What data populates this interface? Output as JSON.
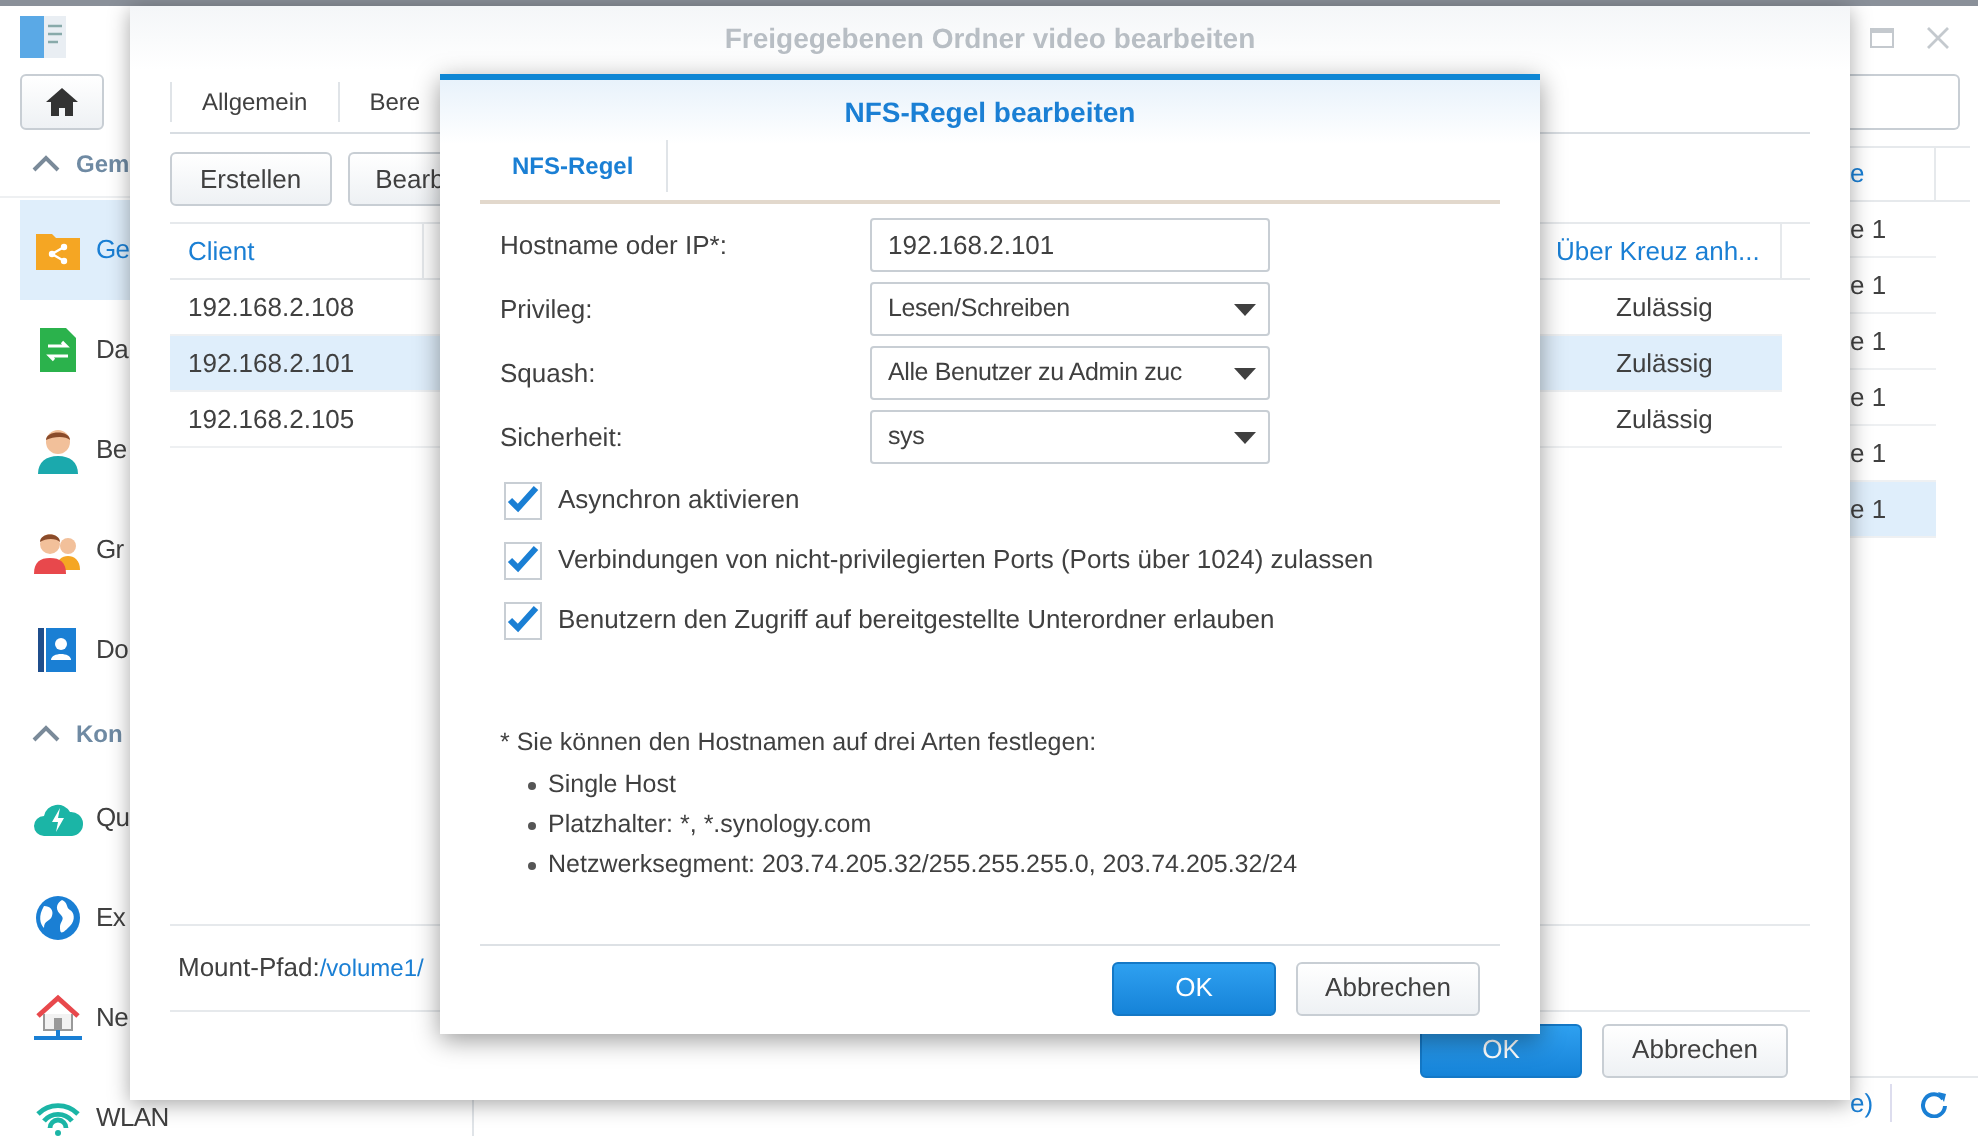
{
  "control_panel": {
    "sidebar": [
      {
        "label": "Gem",
        "expanded": true,
        "items": [
          {
            "label": "Ge",
            "selected": true
          },
          {
            "label": "Da",
            "selected": false
          },
          {
            "label": "Be",
            "selected": false
          },
          {
            "label": "Gr",
            "selected": false
          },
          {
            "label": "Do",
            "selected": false
          }
        ]
      },
      {
        "label": "Kon",
        "expanded": true,
        "items": [
          {
            "label": "Qu",
            "selected": false
          },
          {
            "label": "Ex",
            "selected": false
          },
          {
            "label": "Ne",
            "selected": false
          },
          {
            "label": "WLAN",
            "selected": false
          }
        ]
      }
    ],
    "list": {
      "column": "e",
      "rows": [
        {
          "text": "e 1",
          "selected": false
        },
        {
          "text": "e 1",
          "selected": false
        },
        {
          "text": "e 1",
          "selected": false
        },
        {
          "text": "e 1",
          "selected": false
        },
        {
          "text": "e 1",
          "selected": false
        },
        {
          "text": "e 1",
          "selected": true
        }
      ]
    },
    "footer_text": "e)"
  },
  "share_dialog": {
    "title": "Freigegebenen Ordner video bearbeiten",
    "tabs": [
      {
        "label": "Allgemein",
        "selected": false
      },
      {
        "label": "Bere",
        "selected": false
      }
    ],
    "toolbar": [
      "Erstellen",
      "Bearb"
    ],
    "table": {
      "columns": [
        "Client",
        "Über Kreuz anh..."
      ],
      "rows": [
        {
          "client": "192.168.2.108",
          "cross_mount": "Zulässig",
          "selected": false
        },
        {
          "client": "192.168.2.101",
          "cross_mount": "Zulässig",
          "selected": true
        },
        {
          "client": "192.168.2.105",
          "cross_mount": "Zulässig",
          "selected": false
        }
      ]
    },
    "mount_path": {
      "label": "Mount-Pfad:",
      "value": "/volume1/"
    },
    "buttons": [
      {
        "label": "OK",
        "kind": "primary"
      },
      {
        "label": "Abbrechen",
        "kind": "secondary"
      }
    ]
  },
  "nfs_dialog": {
    "title": "NFS-Regel bearbeiten",
    "tabs": [
      {
        "label": "NFS-Regel",
        "selected": true
      }
    ],
    "fields": [
      {
        "label": "Hostname oder IP*:",
        "kind": "text",
        "value": "192.168.2.101"
      },
      {
        "label": "Privileg:",
        "kind": "select",
        "value": "Lesen/Schreiben"
      },
      {
        "label": "Squash:",
        "kind": "select",
        "value": "Alle Benutzer zu Admin zuc"
      },
      {
        "label": "Sicherheit:",
        "kind": "select",
        "value": "sys"
      }
    ],
    "options": [
      {
        "label": "Asynchron aktivieren",
        "checked": true
      },
      {
        "label": "Verbindungen von nicht-privilegierten Ports (Ports über 1024) zulassen",
        "checked": true
      },
      {
        "label": "Benutzern den Zugriff auf bereitgestellte Unterordner erlauben",
        "checked": true
      }
    ],
    "note": {
      "intro": "* Sie können den Hostnamen auf drei Arten festlegen:",
      "bullets": [
        "Single Host",
        "Platzhalter: *, *.synology.com",
        "Netzwerksegment: 203.74.205.32/255.255.255.0, 203.74.205.32/24"
      ]
    },
    "buttons": [
      {
        "label": "OK",
        "kind": "primary"
      },
      {
        "label": "Abbrechen",
        "kind": "secondary"
      }
    ]
  }
}
